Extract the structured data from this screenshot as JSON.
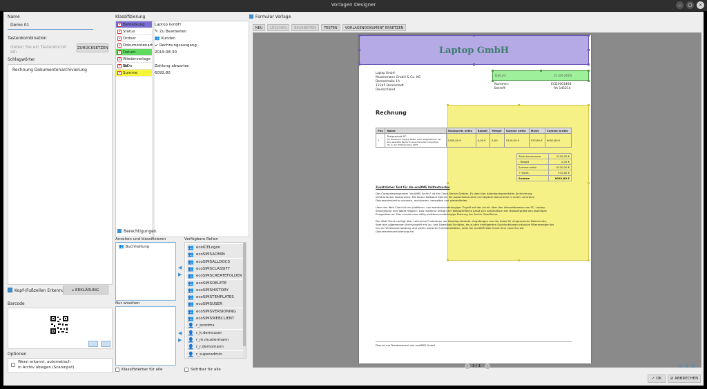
{
  "window": {
    "title": "Vorlagen Designer",
    "buttons": {
      "minimize": "−",
      "maximize": "▢",
      "close": "✕"
    }
  },
  "left": {
    "name_label": "Name",
    "name_value": "Demo 01",
    "shortcut_label": "Tastenkombination",
    "shortcut_placeholder": "Geben Sie ein Tastenkürzel ein",
    "reset_button": "ZURÜCKSETZEN",
    "keywords_label": "Schlagwörter",
    "keywords_value": "Rechnung Dokumentenarchivierung",
    "header_footer_label": "Kopf-/Fußzeilen Erkennung",
    "explanation_button": "ERKLÄRUNG",
    "barcode_label": "Barcode",
    "options_label": "Optionen",
    "option_line1": "Wenn erkannt, automatisch",
    "option_line2": "in Archiv ablegen (Scaninput)"
  },
  "classification": {
    "title": "Klassifizierung",
    "rows": [
      {
        "key": "Bemerkung",
        "value": "Laptop GmbH",
        "color": "#7b6fd6",
        "icon": ""
      },
      {
        "key": "Status",
        "value": "Zu Bearbeiten",
        "color": "",
        "icon": "pencil-icon"
      },
      {
        "key": "Ordner",
        "value": "Kunden",
        "color": "",
        "icon": "users-icon"
      },
      {
        "key": "Dokumentenart",
        "value": "Rechnungsausgang",
        "color": "",
        "icon": "arrow-icon"
      },
      {
        "key": "Datum",
        "value": "2019-08-30",
        "color": "#5fdc5f",
        "icon": ""
      },
      {
        "key": "Wiedervorlage ab",
        "value": "",
        "color": "",
        "icon": ""
      },
      {
        "key": "ToDo",
        "value": "Zahlung abwarten",
        "color": "",
        "icon": ""
      },
      {
        "key": "Summe",
        "value": "6092,80",
        "color": "#f5f53a",
        "icon": ""
      }
    ]
  },
  "permissions": {
    "title": "Berechtigungen",
    "view_classify_label": "Ansehen und klassifizieren",
    "view_classify_items": [
      "Buchhaltung"
    ],
    "view_only_label": "Nur ansehen",
    "available_roles_label": "Verfügbare Rollen",
    "roles": [
      "ecoICELogon",
      "ecoSIMSADMIN",
      "ecoSIMSALLDOCS",
      "ecoSIMSCLASSIFY",
      "ecoSIMSCREATEFOLDER",
      "ecoSIMSDELETE",
      "ecoSIMSHISTORY",
      "ecoSIMSTEMPLATES",
      "ecoSIMSUSER",
      "ecoSIMSVERSIONING",
      "ecoSIMSWEBCLIENT",
      "r_ecodms",
      "r_k.demouser",
      "r_m.mustermann",
      "r_r.demomann",
      "r_superadmin"
    ],
    "classifiable_label": "Klassifizierbar für alle",
    "visible_label": "Sichtbar für alle"
  },
  "preview": {
    "title": "Formular Vorlage",
    "toolbar": {
      "new": "NEU",
      "delete": "LÖSCHEN",
      "edit": "BEARBEITEN",
      "test": "TESTEN",
      "replace": "VORLAGENDOKUMENT ERSETZEN"
    },
    "page_indicator": "1 / 1",
    "doc": {
      "company_header": "Laptop GmbH",
      "sender_line": "Laptop GmbH",
      "recipient": [
        "Mustermann GmbH & Co. KG",
        "Demostraße 1A",
        "12345 Demostadt",
        "Deutschland"
      ],
      "date_label": "Datum:",
      "date_value": "21-04-2019",
      "number_label": "Nummer:",
      "number_value": "ECD3001494",
      "subject_label": "Betreff:",
      "subject_value": "RA 145214",
      "heading": "Rechnung",
      "table_headers": [
        "Pos",
        "Name",
        "Stückpreis netto",
        "Rabatt",
        "Menge",
        "Summe netto",
        "Mwst.",
        "Summe brutto"
      ],
      "table_row": [
        "1",
        "Testprodukt PC",
        "1280,00 €",
        "0,00 €",
        "4,00",
        "5120,00 €",
        "972,80 €",
        "6092,80 €"
      ],
      "item_desc": [
        "Für Notebook, Laptop selber auch Klappnehmen, ist",
        "eine spezielle Bauform eines Personal Computers,",
        "die zu den Mobilgeräten zählt."
      ],
      "sums": [
        [
          "Zwischensumme",
          "5120,00 €"
        ],
        [
          "- Rabatt",
          "0,00 €"
        ],
        [
          "Summe netto",
          "5120,00 €"
        ],
        [
          "+ MwSt.",
          "972,80 €"
        ],
        [
          "Summe",
          "6092,80 €"
        ]
      ],
      "extra_title": "Zusätzlicher Text für die ecoDMS Volltextsuche:",
      "paragraph1": [
        "Das Computerprogramm \"ecoDMS Archiv\" ist ein Client-Server-System. Es dient der datenbankgestützten Archivierung",
        "elektronischer Dokumente. Mit dieser Software können Sie papierdokumente und digitale Dokumente in einem zentralen",
        "Dokumentenarchiv scannen, archivieren, verwalten und wiederfinden."
      ],
      "paragraph2": [
        "Über den Web Client ist ein plattform- und standortunabhängiger Zugriff auf das Archiv über den Internetbrowser am PC, Laptop,",
        "Smartphone und Tablet möglich. Das moderne Design der Weboberfläche passt sich automatisch der Browsergröße des jeweiligen",
        "Endgerätes an. Das erlaubt eine völlig plattformunabhängige Nutzung der Archiv Oberfläche."
      ],
      "paragraph3": [
        "Der Web Client verfügt über zahlreiche Funktionen der Desktop-Variante. Angefangen von der Inbox für eingescannte Dokumente,",
        "über den allgemeinen Archivzugriff mit Up- und Download-Funktion, bis zu den intelligenten Suchfunktionen inklusive Filteranzeigen bis",
        "hin zur Versionsverwaltung und vielen weiteren Funktionalitäten, setzt der ecoDMS Web Client eine neue Ära der",
        "Dokumentenarchivierung ein."
      ],
      "footer": "Dies ist ein Testdokument der ecoDMS GmbH"
    }
  },
  "footer": {
    "ok": "OK",
    "cancel": "ABBRECHEN"
  },
  "colors": {
    "accent": "#3c8fd0",
    "purple_zone": "#b5a9e6",
    "green_zone": "#9ef09a",
    "yellow_zone": "#f4f07a"
  }
}
